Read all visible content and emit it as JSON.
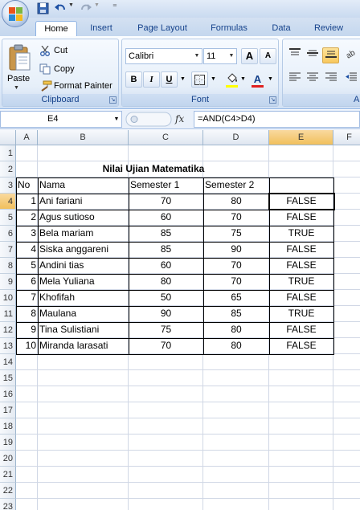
{
  "colors": {
    "accent": "#15428b",
    "ribbon_bg": "#dbe7f6",
    "selection_header": "#f1c05c",
    "font_color_bar": "#e02020",
    "highlight_bar": "#ffff00"
  },
  "quick_access": {
    "icons": [
      "save-icon",
      "undo-icon",
      "redo-icon",
      "customize-icon"
    ],
    "separator": "⁼"
  },
  "tabs": [
    {
      "label": "Home",
      "active": true
    },
    {
      "label": "Insert",
      "active": false
    },
    {
      "label": "Page Layout",
      "active": false
    },
    {
      "label": "Formulas",
      "active": false
    },
    {
      "label": "Data",
      "active": false
    },
    {
      "label": "Review",
      "active": false
    }
  ],
  "ribbon": {
    "clipboard": {
      "label": "Clipboard",
      "paste": "Paste",
      "cut": "Cut",
      "copy": "Copy",
      "format_painter": "Format Painter"
    },
    "font": {
      "label": "Font",
      "font_name": "Calibri",
      "font_size": "11",
      "bold": "B",
      "italic": "I",
      "underline": "U",
      "font_color_letter": "A",
      "grow_letter": "A",
      "shrink_letter": "A"
    },
    "alignment": {
      "label": "A"
    }
  },
  "formula_bar": {
    "name_box": "E4",
    "fx": "fx",
    "formula": "=AND(C4>D4)"
  },
  "grid": {
    "columns": [
      "A",
      "B",
      "C",
      "D",
      "E",
      "F"
    ],
    "rows": [
      "1",
      "2",
      "3",
      "4",
      "5",
      "6",
      "7",
      "8",
      "9",
      "10",
      "11",
      "12",
      "13",
      "14",
      "15",
      "16",
      "17",
      "18",
      "19",
      "20",
      "21",
      "22",
      "23"
    ],
    "title": "Nilai Ujian Matematika",
    "headers": {
      "no": "No",
      "nama": "Nama",
      "sem1": "Semester 1",
      "sem2": "Semester 2"
    },
    "records": [
      {
        "no": "1",
        "nama": "Ani fariani",
        "sem1": "70",
        "sem2": "80",
        "result": "FALSE"
      },
      {
        "no": "2",
        "nama": "Agus sutioso",
        "sem1": "60",
        "sem2": "70",
        "result": "FALSE"
      },
      {
        "no": "3",
        "nama": "Bela mariam",
        "sem1": "85",
        "sem2": "75",
        "result": "TRUE"
      },
      {
        "no": "4",
        "nama": "Siska anggareni",
        "sem1": "85",
        "sem2": "90",
        "result": "FALSE"
      },
      {
        "no": "5",
        "nama": "Andini tias",
        "sem1": "60",
        "sem2": "70",
        "result": "FALSE"
      },
      {
        "no": "6",
        "nama": "Mela Yuliana",
        "sem1": "80",
        "sem2": "70",
        "result": "TRUE"
      },
      {
        "no": "7",
        "nama": "Khofifah",
        "sem1": "50",
        "sem2": "65",
        "result": "FALSE"
      },
      {
        "no": "8",
        "nama": "Maulana",
        "sem1": "90",
        "sem2": "85",
        "result": "TRUE"
      },
      {
        "no": "9",
        "nama": "Tina Sulistiani",
        "sem1": "75",
        "sem2": "80",
        "result": "FALSE"
      },
      {
        "no": "10",
        "nama": "Miranda larasati",
        "sem1": "70",
        "sem2": "80",
        "result": "FALSE"
      }
    ]
  }
}
